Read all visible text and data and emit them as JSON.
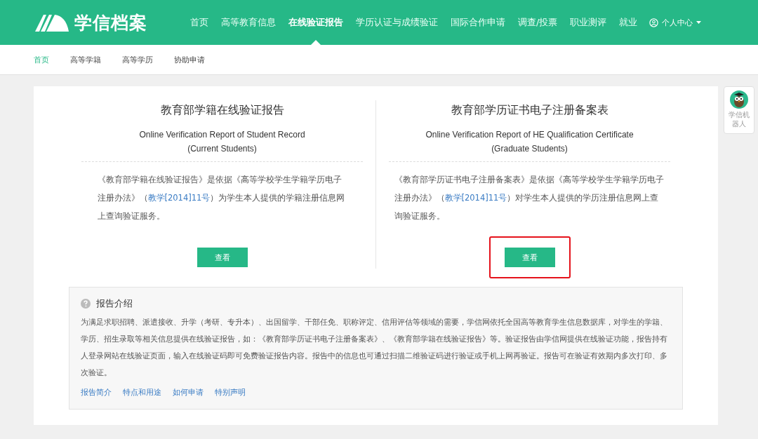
{
  "header": {
    "logo_text": "学信档案",
    "nav": [
      {
        "label": "首页",
        "selected": false
      },
      {
        "label": "高等教育信息",
        "selected": false
      },
      {
        "label": "在线验证报告",
        "selected": true
      },
      {
        "label": "学历认证与成绩验证",
        "selected": false
      },
      {
        "label": "国际合作申请",
        "selected": false
      },
      {
        "label": "调查/投票",
        "selected": false
      },
      {
        "label": "职业测评",
        "selected": false
      },
      {
        "label": "就业",
        "selected": false
      }
    ],
    "user_menu": "个人中心"
  },
  "subnav": [
    {
      "label": "首页",
      "selected": true
    },
    {
      "label": "高等学籍",
      "selected": false
    },
    {
      "label": "高等学历",
      "selected": false
    },
    {
      "label": "协助申请",
      "selected": false
    }
  ],
  "reports": [
    {
      "title": "教育部学籍在线验证报告",
      "subtitle_en": "Online Verification Report of Student Record",
      "subtitle_note": "(Current Students)",
      "desc_before": "《教育部学籍在线验证报告》是依据《高等学校学生学籍学历电子注册办法》（",
      "desc_link": "教学[2014]11号",
      "desc_after": "）为学生本人提供的学籍注册信息网上查询验证服务。",
      "button": "查看",
      "highlighted": false
    },
    {
      "title": "教育部学历证书电子注册备案表",
      "subtitle_en": "Online Verification Report of HE Qualification Certificate",
      "subtitle_note": "(Graduate Students)",
      "desc_before": "《教育部学历证书电子注册备案表》是依据《高等学校学生学籍学历电子注册办法》（",
      "desc_link": "教学[2014]11号",
      "desc_after": "）对学生本人提供的学历注册信息网上查询验证服务。",
      "button": "查看",
      "highlighted": true
    }
  ],
  "intro": {
    "title": "报告介绍",
    "text": "为满足求职招聘、派遣接收、升学（考研、专升本）、出国留学、干部任免、职称评定、信用评估等领域的需要，学信网依托全国高等教育学生信息数据库，对学生的学籍、学历、招生录取等相关信息提供在线验证报告，如：《教育部学历证书电子注册备案表》、《教育部学籍在线验证报告》等。验证报告由学信网提供在线验证功能，报告持有人登录网站在线验证页面，输入在线验证码即可免费验证报告内容。报告中的信息也可通过扫描二维验证码进行验证或手机上网再验证。报告可在验证有效期内多次打印、多次验证。",
    "links": [
      "报告简介",
      "特点和用途",
      "如何申请",
      "特别声明"
    ]
  },
  "robot": {
    "label": "学信机器人"
  }
}
